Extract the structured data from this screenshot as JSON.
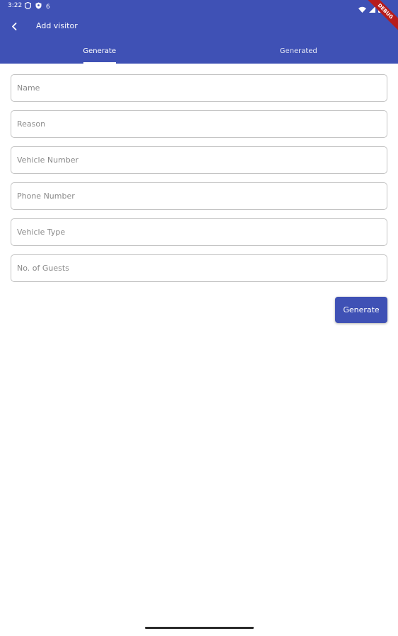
{
  "status_bar": {
    "time": "3:22",
    "icons_left": [
      "shield-icon",
      "shield-badge-icon"
    ],
    "notification_count": "6",
    "icons_right": [
      "wifi-icon",
      "signal-icon",
      "battery-icon"
    ]
  },
  "debug_banner": "DEBUG",
  "appbar": {
    "title": "Add visitor",
    "back_icon": "chevron-left-icon",
    "color": "#3f51b5"
  },
  "tabs": [
    {
      "label": "Generate",
      "active": true
    },
    {
      "label": "Generated",
      "active": false
    }
  ],
  "form": {
    "fields": [
      {
        "placeholder": "Name",
        "value": ""
      },
      {
        "placeholder": "Reason",
        "value": ""
      },
      {
        "placeholder": "Vehicle Number",
        "value": ""
      },
      {
        "placeholder": "Phone Number",
        "value": ""
      },
      {
        "placeholder": "Vehicle Type",
        "value": ""
      },
      {
        "placeholder": "No. of Guests",
        "value": ""
      }
    ],
    "submit_label": "Generate"
  }
}
